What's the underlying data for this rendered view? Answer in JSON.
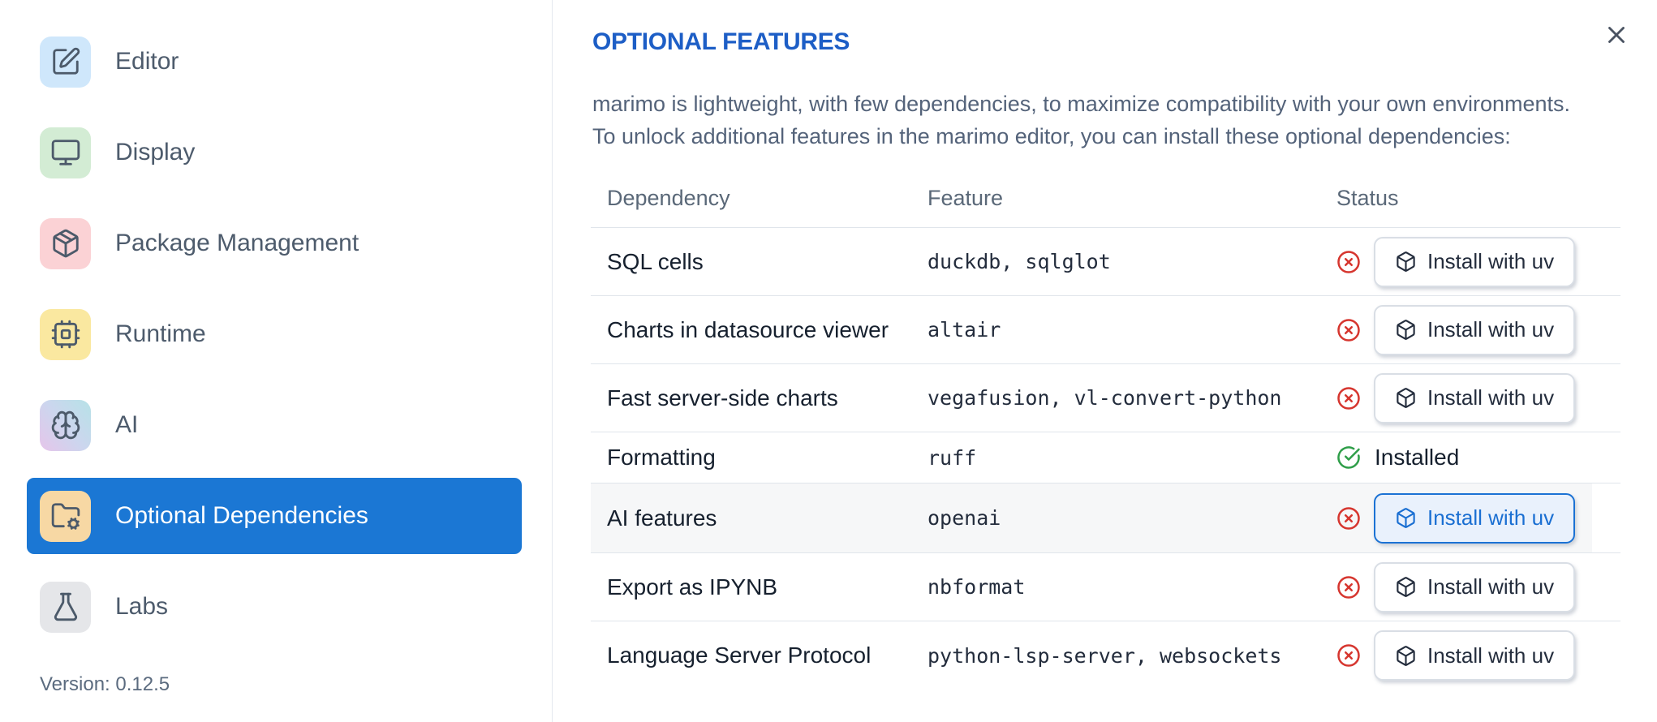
{
  "sidebar": {
    "items": [
      {
        "id": "editor",
        "label": "Editor",
        "icon": "square-pen-icon",
        "icon_bg": "#cfe7fb",
        "selected": false
      },
      {
        "id": "display",
        "label": "Display",
        "icon": "monitor-icon",
        "icon_bg": "#d3ecd4",
        "selected": false
      },
      {
        "id": "package-management",
        "label": "Package Management",
        "icon": "package-icon",
        "icon_bg": "#fbd2d5",
        "selected": false
      },
      {
        "id": "runtime",
        "label": "Runtime",
        "icon": "cpu-icon",
        "icon_bg": "#fae8a0",
        "selected": false
      },
      {
        "id": "ai",
        "label": "AI",
        "icon": "brain-icon",
        "icon_bg": "linear-gradient(50deg, #e6c5ea 0%, #ccd6ee 50%, #b6e2e7 100%)",
        "selected": false
      },
      {
        "id": "optional-dependencies",
        "label": "Optional Dependencies",
        "icon": "folder-cog-icon",
        "icon_bg": "#f7d8a4",
        "selected": true
      },
      {
        "id": "labs",
        "label": "Labs",
        "icon": "flask-icon",
        "icon_bg": "#e5e6e9",
        "selected": false
      }
    ],
    "version_label": "Version: 0.12.5"
  },
  "panel": {
    "title": "OPTIONAL FEATURES",
    "description_lines": [
      "marimo is lightweight, with few dependencies, to maximize compatibility with your own environments.",
      "To unlock additional features in the marimo editor, you can install these optional dependencies:"
    ],
    "close_icon": "x-icon"
  },
  "table": {
    "headers": [
      "Dependency",
      "Feature",
      "Status"
    ],
    "rows": [
      {
        "dependency": "SQL cells",
        "feature": "duckdb, sqlglot",
        "installed": false,
        "status_icon": "circle-x-icon",
        "action_icon": "box-icon",
        "action_label": "Install with uv",
        "highlighted": false
      },
      {
        "dependency": "Charts in datasource viewer",
        "feature": "altair",
        "installed": false,
        "status_icon": "circle-x-icon",
        "action_icon": "box-icon",
        "action_label": "Install with uv",
        "highlighted": false
      },
      {
        "dependency": "Fast server-side charts",
        "feature": "vegafusion, vl-convert-python",
        "installed": false,
        "status_icon": "circle-x-icon",
        "action_icon": "box-icon",
        "action_label": "Install with uv",
        "highlighted": false
      },
      {
        "dependency": "Formatting",
        "feature": "ruff",
        "installed": true,
        "status_icon": "circle-check-icon",
        "status_label": "Installed",
        "highlighted": false
      },
      {
        "dependency": "AI features",
        "feature": "openai",
        "installed": false,
        "status_icon": "circle-x-icon",
        "action_icon": "box-icon",
        "action_label": "Install with uv",
        "highlighted": true
      },
      {
        "dependency": "Export as IPYNB",
        "feature": "nbformat",
        "installed": false,
        "status_icon": "circle-x-icon",
        "action_icon": "box-icon",
        "action_label": "Install with uv",
        "highlighted": false
      },
      {
        "dependency": "Language Server Protocol",
        "feature": "python-lsp-server, websockets",
        "installed": false,
        "status_icon": "circle-x-icon",
        "action_icon": "box-icon",
        "action_label": "Install with uv",
        "highlighted": false
      }
    ]
  },
  "colors": {
    "title_blue": "#1d5ec6",
    "selected_item_blue": "#1b77d4",
    "error_red": "#d6362f",
    "success_green": "#2f9e49",
    "primary_button_blue": "#1a6fd2"
  }
}
